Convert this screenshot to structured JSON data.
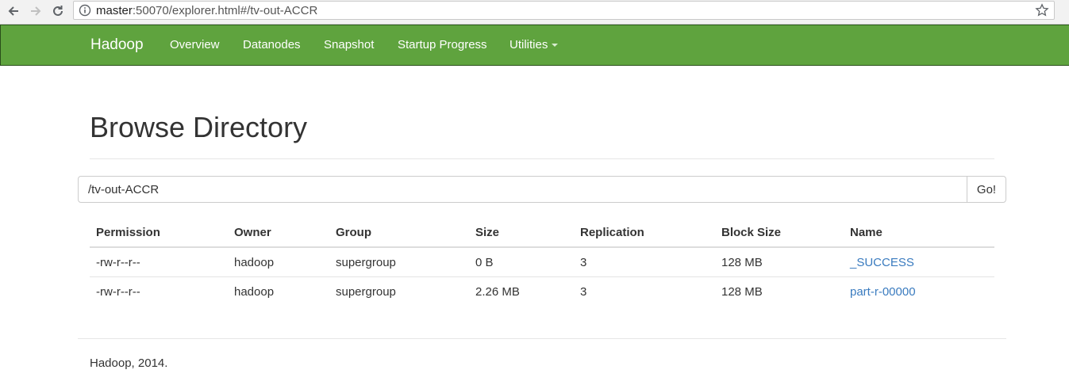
{
  "browser": {
    "url_host": "master",
    "url_rest": ":50070/explorer.html#/tv-out-ACCR"
  },
  "navbar": {
    "brand": "Hadoop",
    "items": [
      "Overview",
      "Datanodes",
      "Snapshot",
      "Startup Progress",
      "Utilities"
    ],
    "background": "#5fa33e"
  },
  "main": {
    "title": "Browse Directory",
    "path_value": "/tv-out-ACCR",
    "go_label": "Go!"
  },
  "table": {
    "headers": [
      "Permission",
      "Owner",
      "Group",
      "Size",
      "Replication",
      "Block Size",
      "Name"
    ],
    "rows": [
      [
        "-rw-r--r--",
        "hadoop",
        "supergroup",
        "0 B",
        "3",
        "128 MB",
        "_SUCCESS"
      ],
      [
        "-rw-r--r--",
        "hadoop",
        "supergroup",
        "2.26 MB",
        "3",
        "128 MB",
        "part-r-00000"
      ]
    ]
  },
  "footer": {
    "text": "Hadoop, 2014."
  },
  "icons": {
    "back": "arrow-left-icon",
    "forward": "arrow-right-icon",
    "reload": "reload-icon",
    "info": "info-icon",
    "bookmark": "star-icon"
  },
  "colors": {
    "link": "#3a7bbf"
  }
}
